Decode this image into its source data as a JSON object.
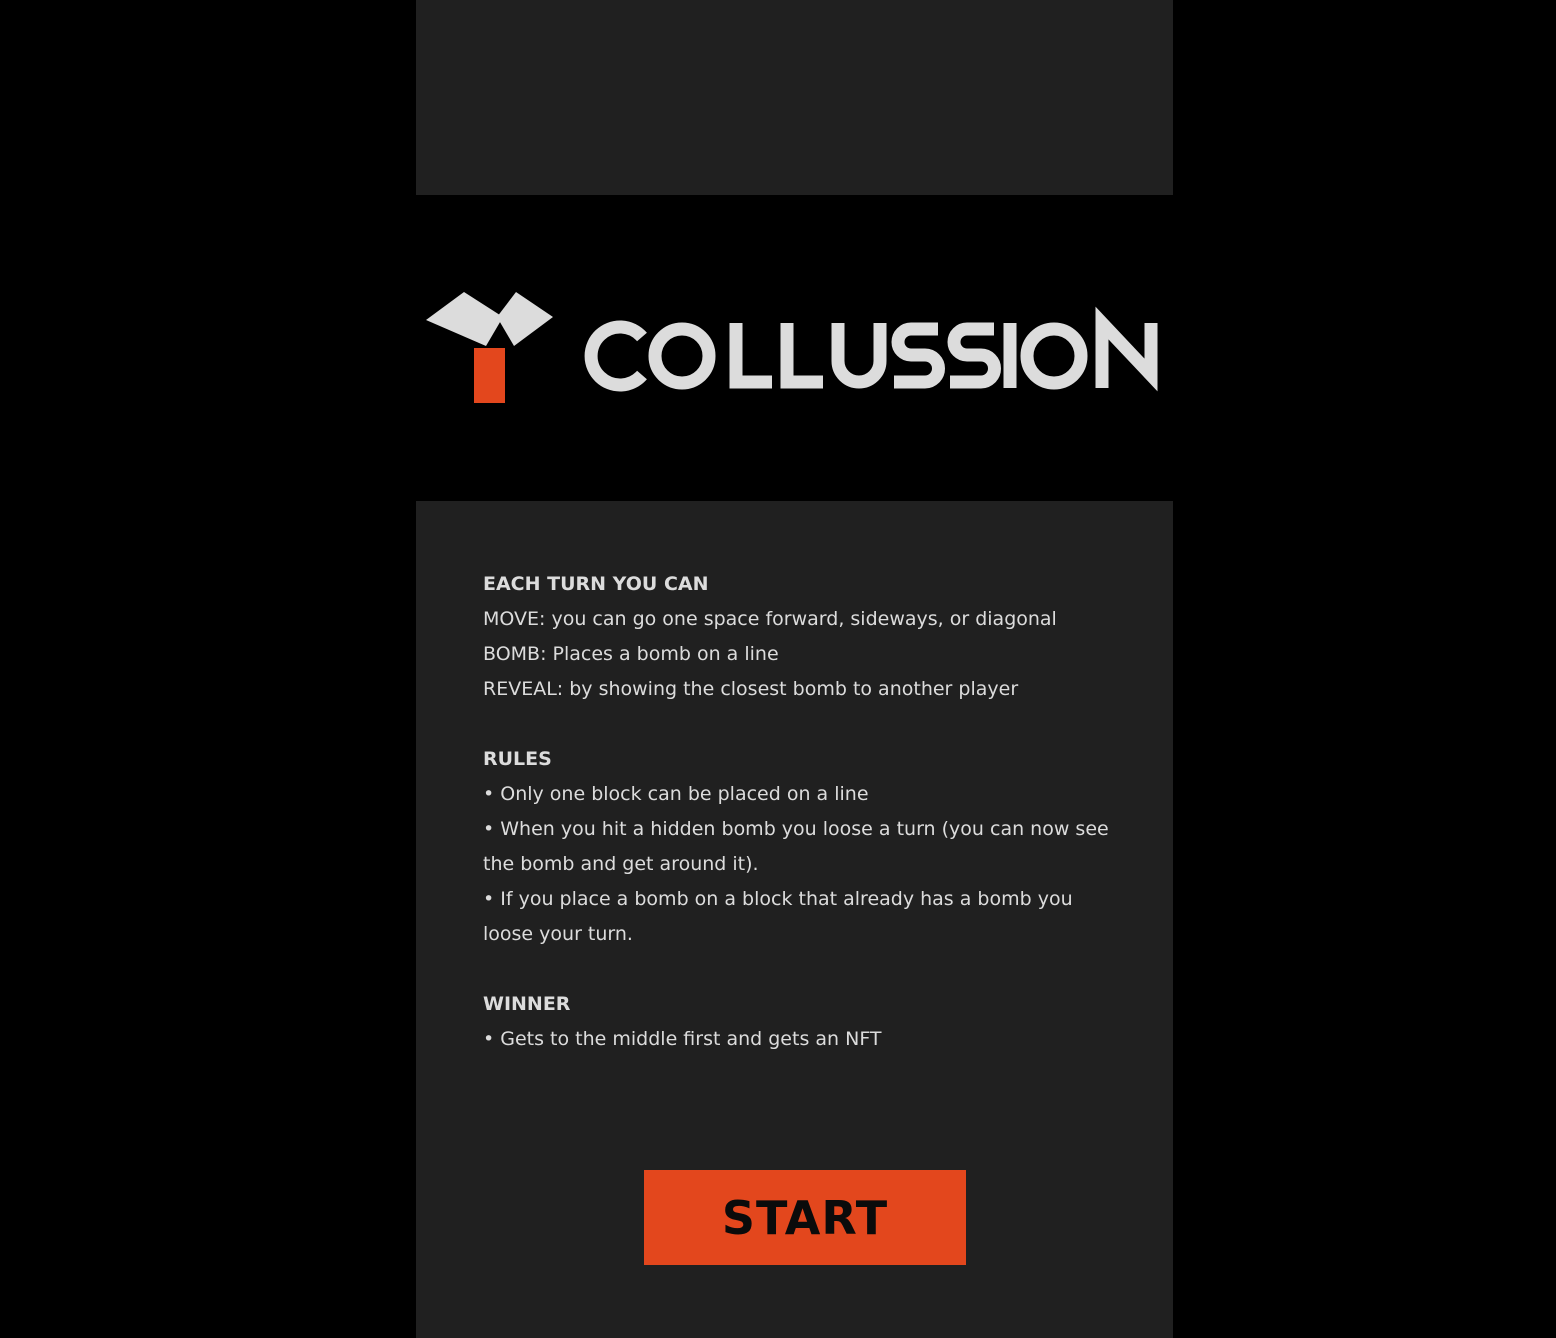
{
  "brand": {
    "name": "COLLUSSION",
    "accent_color": "#e3471d",
    "logo_mark": "y-block-logo-icon"
  },
  "rules": {
    "each_turn": {
      "heading": "EACH TURN YOU CAN",
      "items": [
        "MOVE: you can go one space forward, sideways, or diagonal",
        "BOMB: Places a bomb on a line",
        "REVEAL: by showing the closest bomb to another player"
      ]
    },
    "rules_section": {
      "heading": "RULES",
      "items": [
        "• Only one block can be placed on a line",
        "• When you hit a hidden bomb you loose a turn (you can now see the bomb and get around it).",
        "• If you place a bomb on a block that already has a bomb you loose your turn."
      ]
    },
    "winner": {
      "heading": "WINNER",
      "items": [
        "• Gets to the middle first and gets an NFT"
      ]
    }
  },
  "start_button": {
    "label": "START"
  }
}
